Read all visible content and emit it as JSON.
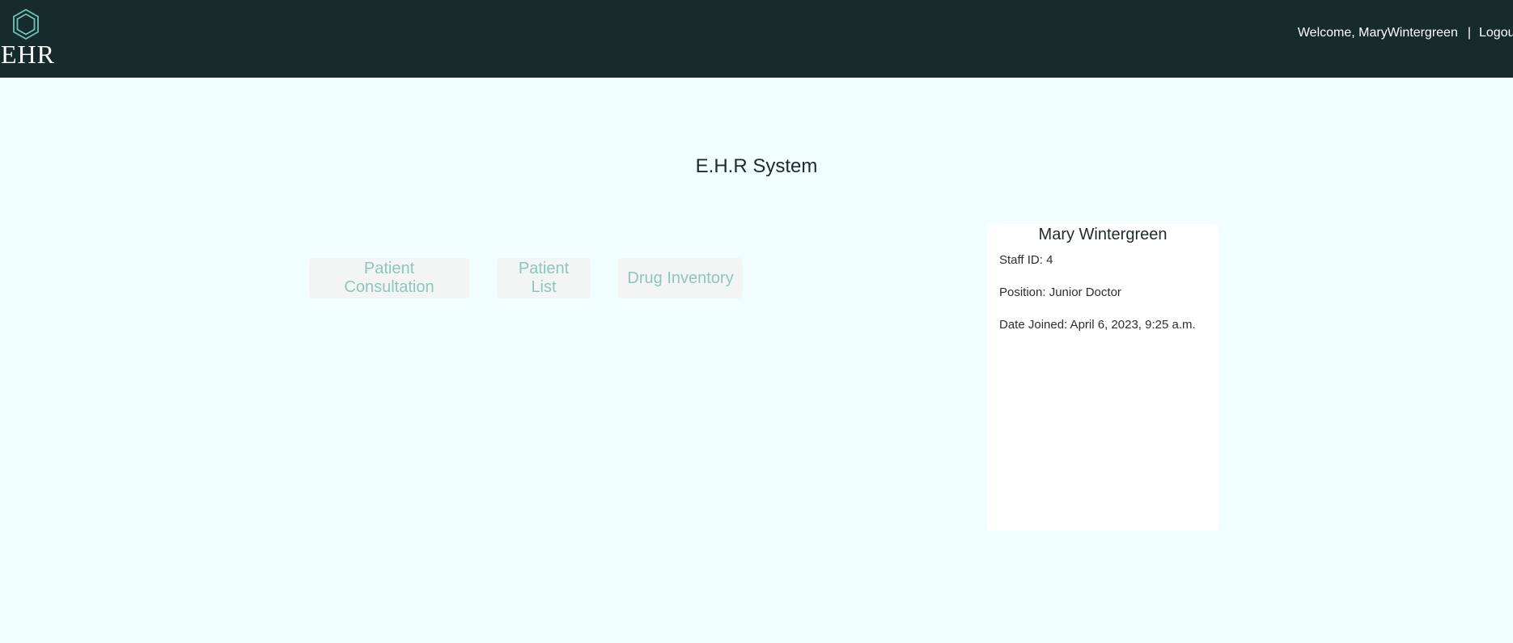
{
  "navbar": {
    "brand_text": "EHR",
    "brand_icon": "hexagon-icon",
    "welcome_text": "Welcome, MaryWintergreen",
    "separator": "|",
    "logout_label": "Logout",
    "background_color": "#182b2c",
    "accent_color": "#6fc4b8"
  },
  "main": {
    "title": "E.H.R System",
    "buttons": [
      {
        "label": "Patient Consultation"
      },
      {
        "label": "Patient List"
      },
      {
        "label": "Drug Inventory"
      }
    ]
  },
  "profile": {
    "name": "Mary Wintergreen",
    "staff_id": "Staff ID: 4",
    "position": "Position: Junior Doctor",
    "date_joined": "Date Joined: April 6, 2023, 9:25 a.m."
  }
}
